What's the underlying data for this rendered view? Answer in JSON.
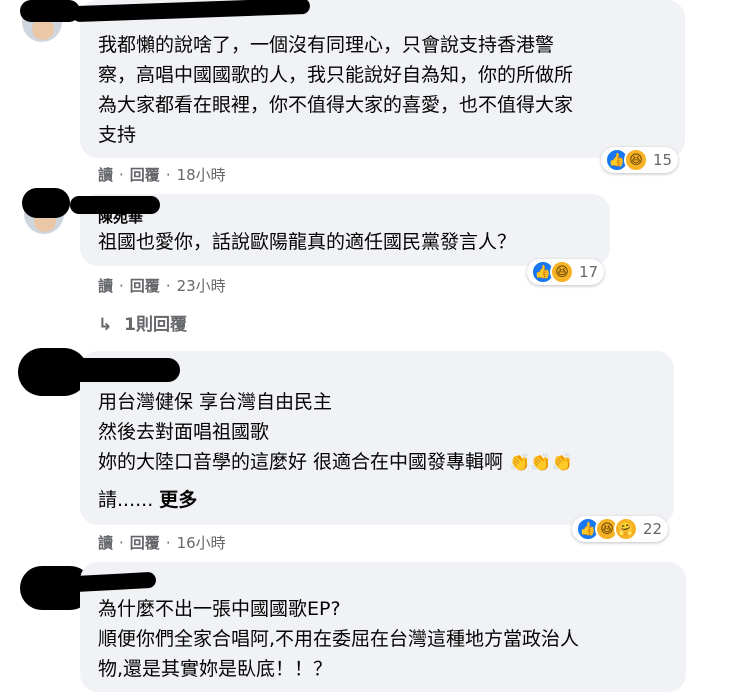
{
  "comments": [
    {
      "name": "",
      "lines": [
        "我都懶的說啥了，一個沒有同理心，只會說支持香港警",
        "察，高唱中國國歌的人，我只能說好自為知，你的所做所",
        "為大家都看在眼裡，你不值得大家的喜愛，也不值得大家",
        "支持"
      ],
      "actions": {
        "read": "讀",
        "reply": "回覆",
        "time": "18小時"
      },
      "reactions": {
        "count": "15",
        "icons": [
          "like-icon",
          "haha-icon"
        ]
      }
    },
    {
      "name": "陳苑華",
      "lines": [
        "祖國也愛你，話說歐陽龍真的適任國民黨發言人？"
      ],
      "actions": {
        "read": "讀",
        "reply": "回覆",
        "time": "23小時"
      },
      "reactions": {
        "count": "17",
        "icons": [
          "like-icon",
          "haha-icon"
        ]
      },
      "replies_label": "1則回覆"
    },
    {
      "name": "",
      "lines": [
        "用台灣健保 享台灣自由民主",
        "然後去對面唱祖國歌",
        "妳的大陸口音學的這麼好 很適合在中國發專輯啊"
      ],
      "emoji_note": "clap x3",
      "truncated": "請......",
      "more_label": "更多",
      "actions": {
        "read": "讀",
        "reply": "回覆",
        "time": "16小時"
      },
      "reactions": {
        "count": "22",
        "icons": [
          "like-icon",
          "haha-icon",
          "care-icon"
        ]
      }
    },
    {
      "name": "",
      "lines": [
        "為什麼不出一張中國國歌EP?",
        "順便你們全家合唱阿,不用在委屈在台灣這種地方當政治人",
        "物,還是其實妳是臥底！！？"
      ]
    }
  ],
  "glyphs": {
    "separator": "·",
    "reply_arrow": "↳",
    "like": "👍",
    "haha": "😆",
    "care": "🤗",
    "clap": "👏"
  }
}
